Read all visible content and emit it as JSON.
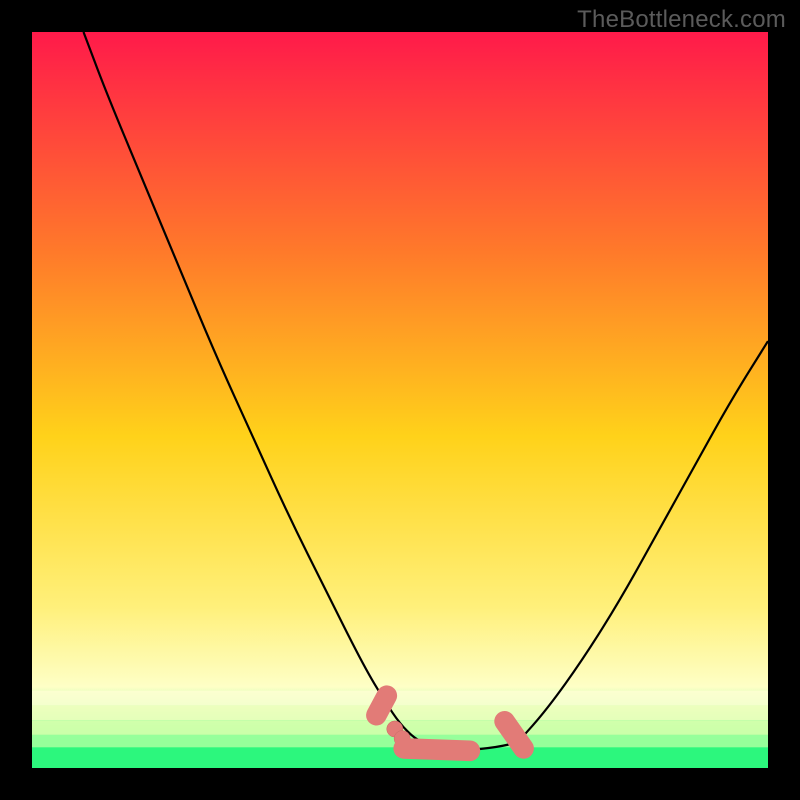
{
  "watermark": "TheBottleneck.com",
  "colors": {
    "bg": "#000000",
    "grad_top": "#ff1a4a",
    "grad_mid1": "#ff7a2a",
    "grad_mid2": "#ffd21a",
    "grad_mid3": "#fff07a",
    "grad_pale": "#feffc6",
    "grad_green": "#2cf77d",
    "curve": "#000000",
    "marker_fill": "#e27b77",
    "marker_stroke": "#c76b66"
  },
  "chart_data": {
    "type": "line",
    "title": "",
    "xlabel": "",
    "ylabel": "",
    "xlim": [
      0,
      100
    ],
    "ylim": [
      0,
      100
    ],
    "series": [
      {
        "name": "left-branch",
        "x": [
          7,
          10,
          15,
          20,
          25,
          30,
          35,
          40,
          45,
          48,
          50,
          52,
          54
        ],
        "y": [
          100,
          92,
          80,
          68,
          56,
          45,
          34,
          24,
          14,
          9,
          6,
          4,
          3
        ]
      },
      {
        "name": "valley",
        "x": [
          54,
          56,
          58,
          60,
          62,
          64,
          66
        ],
        "y": [
          3,
          2.5,
          2.5,
          2.5,
          2.7,
          3,
          3.5
        ]
      },
      {
        "name": "right-branch",
        "x": [
          66,
          70,
          75,
          80,
          85,
          90,
          95,
          100
        ],
        "y": [
          3.5,
          8,
          15,
          23,
          32,
          41,
          50,
          58
        ]
      }
    ],
    "markers": [
      {
        "shape": "cap-left",
        "x": 47.5,
        "y": 8.5,
        "len": 3,
        "angle": 62
      },
      {
        "shape": "dot",
        "x": 49.3,
        "y": 5.3,
        "r": 1.1
      },
      {
        "shape": "dot",
        "x": 50.3,
        "y": 4.0,
        "r": 1.1
      },
      {
        "shape": "cap-flat",
        "x": 55,
        "y": 2.5,
        "len": 9,
        "angle": -2
      },
      {
        "shape": "cap-right",
        "x": 65.5,
        "y": 4.5,
        "len": 4.5,
        "angle": -55
      }
    ],
    "gradient_bands": [
      {
        "y": 0,
        "color": "#ff1a4a"
      },
      {
        "y": 30,
        "color": "#ff7a2a"
      },
      {
        "y": 55,
        "color": "#ffd21a"
      },
      {
        "y": 78,
        "color": "#fff07a"
      },
      {
        "y": 89,
        "color": "#feffc6"
      },
      {
        "y": 96.5,
        "color": "#2cf77d"
      }
    ]
  }
}
